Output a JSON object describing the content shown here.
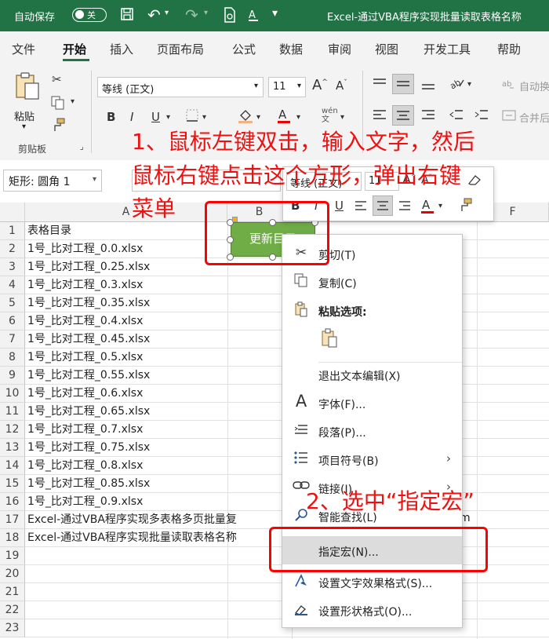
{
  "title_bar": {
    "autosave_label": "自动保存",
    "autosave_state": "关",
    "title": "Excel-通过VBA程序实现批量读取表格名称"
  },
  "tabs": [
    "文件",
    "开始",
    "插入",
    "页面布局",
    "公式",
    "数据",
    "审阅",
    "视图",
    "开发工具",
    "帮助"
  ],
  "ribbon": {
    "paste_label": "粘贴",
    "clipboard_group": "剪贴板",
    "font_name": "等线 (正文)",
    "font_size": "11",
    "wrap_label": "自动换",
    "merge_label": "合并后"
  },
  "name_box": "矩形: 圆角 1",
  "mini_toolbar": {
    "font_name": "等线 (正文)",
    "font_size": "11"
  },
  "columns": [
    "A",
    "B",
    "F"
  ],
  "rows": [
    {
      "num": "1",
      "text": "表格目录"
    },
    {
      "num": "2",
      "text": "1号_比对工程_0.0.xlsx"
    },
    {
      "num": "3",
      "text": "1号_比对工程_0.25.xlsx"
    },
    {
      "num": "4",
      "text": "1号_比对工程_0.3.xlsx"
    },
    {
      "num": "5",
      "text": "1号_比对工程_0.35.xlsx"
    },
    {
      "num": "6",
      "text": "1号_比对工程_0.4.xlsx"
    },
    {
      "num": "7",
      "text": "1号_比对工程_0.45.xlsx"
    },
    {
      "num": "8",
      "text": "1号_比对工程_0.5.xlsx"
    },
    {
      "num": "9",
      "text": "1号_比对工程_0.55.xlsx"
    },
    {
      "num": "10",
      "text": "1号_比对工程_0.6.xlsx"
    },
    {
      "num": "11",
      "text": "1号_比对工程_0.65.xlsx"
    },
    {
      "num": "12",
      "text": "1号_比对工程_0.7.xlsx"
    },
    {
      "num": "13",
      "text": "1号_比对工程_0.75.xlsx"
    },
    {
      "num": "14",
      "text": "1号_比对工程_0.8.xlsx"
    },
    {
      "num": "15",
      "text": "1号_比对工程_0.85.xlsx"
    },
    {
      "num": "16",
      "text": "1号_比对工程_0.9.xlsx"
    },
    {
      "num": "17",
      "text": "Excel-通过VBA程序实现多表格多页批量复"
    },
    {
      "num": "18",
      "text": "Excel-通过VBA程序实现批量读取表格名称"
    },
    {
      "num": "19",
      "text": ""
    },
    {
      "num": "20",
      "text": ""
    },
    {
      "num": "21",
      "text": ""
    },
    {
      "num": "22",
      "text": ""
    },
    {
      "num": "23",
      "text": ""
    }
  ],
  "overflow_fragment": "m",
  "shape_text": "更新目录",
  "context_menu": {
    "items": [
      {
        "label": "剪切(T)",
        "icon": "scissors-icon"
      },
      {
        "label": "复制(C)",
        "icon": "copy-icon"
      },
      {
        "label": "粘贴选项:",
        "icon": "paste-icon"
      },
      {
        "label": "退出文本编辑(X)",
        "icon": ""
      },
      {
        "label": "字体(F)...",
        "icon": "font-icon"
      },
      {
        "label": "段落(P)...",
        "icon": "paragraph-icon"
      },
      {
        "label": "项目符号(B)",
        "icon": "bullets-icon"
      },
      {
        "label": "链接(I)",
        "icon": "link-icon"
      },
      {
        "label": "智能查找(L)",
        "icon": "smart-lookup-icon"
      },
      {
        "label": "指定宏(N)...",
        "icon": ""
      },
      {
        "label": "设置文字效果格式(S)...",
        "icon": "text-effects-icon"
      },
      {
        "label": "设置形状格式(O)...",
        "icon": "shape-format-icon"
      }
    ]
  },
  "annotations": {
    "step1_line1": "1、鼠标左键双击，输入文字，然后",
    "step1_line2": "鼠标右键点击这个方形，弹出右键",
    "step1_line3": "菜单",
    "step2": "2、选中“指定宏”"
  },
  "colors": {
    "excel_green": "#217346",
    "shape_green": "#70ad47",
    "annotation_red": "#ee1111"
  }
}
